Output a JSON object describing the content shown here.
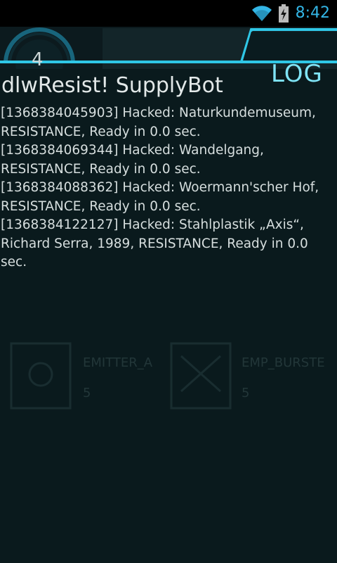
{
  "status_bar": {
    "time": "8:42",
    "icons": [
      "wifi-icon",
      "battery-charging-icon"
    ],
    "accent_color": "#33b5e5"
  },
  "header": {
    "level": "4",
    "tab_label": "LOG",
    "accent_color": "#2fc7e6"
  },
  "log": {
    "title": "dlwResist! SupplyBot",
    "entries": [
      "[1368384045903] Hacked: Naturkundemuseum, RESISTANCE, Ready in 0.0 sec.",
      "[1368384069344] Hacked: Wandelgang, RESISTANCE, Ready in 0.0 sec.",
      "[1368384088362] Hacked: Woermann'scher Hof, RESISTANCE, Ready in 0.0 sec.",
      "[1368384122127] Hacked: Stahlplastik „Axis“, Richard Serra, 1989, RESISTANCE, Ready in 0.0 sec."
    ]
  },
  "background": {
    "items": [
      {
        "label": "EMITTER_A",
        "count": "5"
      },
      {
        "label": "EMP_BURSTE",
        "count": "5"
      }
    ]
  }
}
